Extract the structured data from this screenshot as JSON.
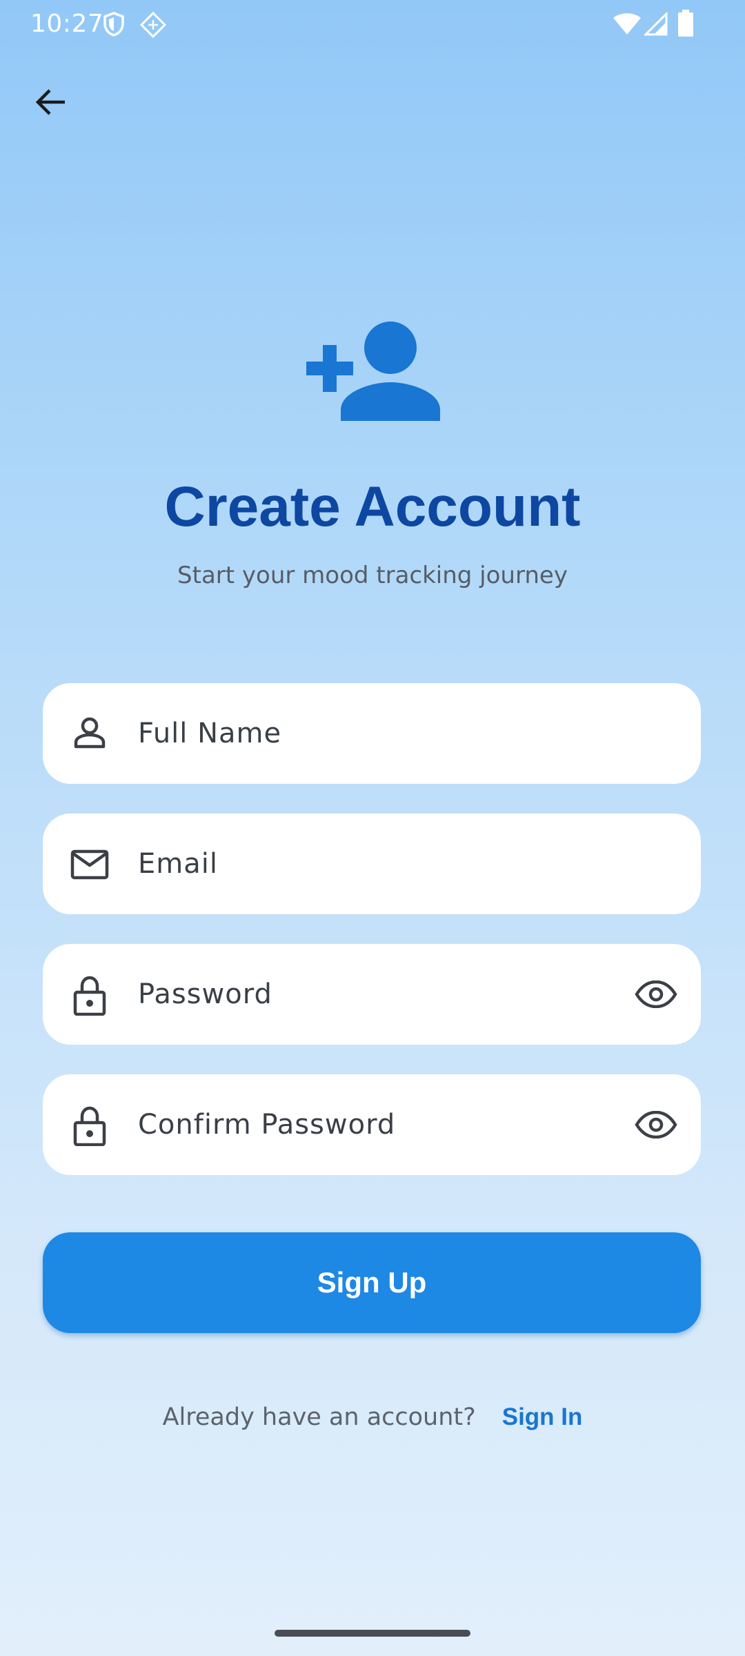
{
  "status_bar": {
    "time": "10:27",
    "left_icons": [
      "shield-icon",
      "diamond-grid-icon"
    ],
    "right_icons": [
      "wifi-icon",
      "signal-icon",
      "battery-icon"
    ]
  },
  "nav": {
    "back_icon": "arrow-back-icon"
  },
  "header": {
    "icon": "person-add-icon",
    "title": "Create Account",
    "subtitle": "Start your mood tracking journey"
  },
  "form": {
    "full_name": {
      "placeholder": "Full Name",
      "icon": "person-icon"
    },
    "email": {
      "placeholder": "Email",
      "icon": "mail-icon"
    },
    "password": {
      "placeholder": "Password",
      "icon": "lock-icon",
      "toggle_icon": "eye-icon"
    },
    "confirm_password": {
      "placeholder": "Confirm Password",
      "icon": "lock-icon",
      "toggle_icon": "eye-icon"
    }
  },
  "signup_button": {
    "label": "Sign Up"
  },
  "footer": {
    "prompt": "Already have an account?",
    "link": "Sign In"
  },
  "colors": {
    "accent": "#1e88e5",
    "title": "#0d47a1",
    "link": "#1976d2",
    "background_top": "#92c8f7",
    "background_bottom": "#e2effb"
  }
}
